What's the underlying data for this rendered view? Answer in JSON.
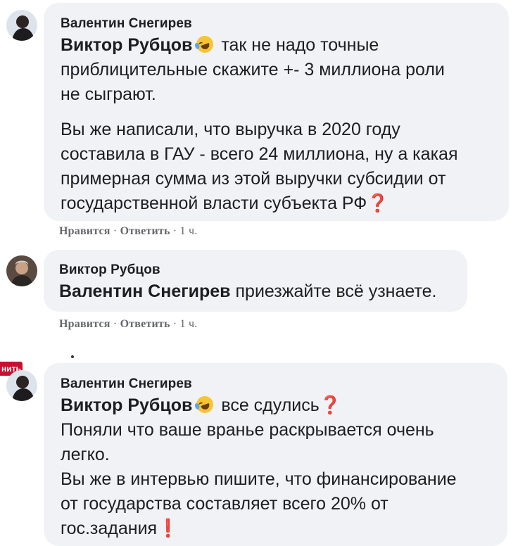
{
  "comments": [
    {
      "author": "Валентин Снегирев",
      "mention": "Виктор Рубцов",
      "line1_rest": "так не надо точные",
      "line2": "приблицительные скажите +- 3 миллиона роли",
      "line3": "не сыграют.",
      "para2": [
        "Вы же написали, что выручка в 2020 году",
        "составила в ГАУ - всего 24 миллиона, ну а какая",
        "примерная сумма из этой выручки субсидии от",
        "государственной власти субъекта РФ"
      ],
      "para2_end_mark": "❓",
      "actions": {
        "like": "Нравится",
        "sep1": " · ",
        "reply": "Ответить",
        "sep2": " · ",
        "time": "1 ч."
      }
    },
    {
      "author": "Виктор Рубцов",
      "mention": "Валентин Снегирев",
      "text": "приезжайте всё узнаете.",
      "actions": {
        "like": "Нравится",
        "sep1": " · ",
        "reply": "Ответить",
        "sep2": " · ",
        "time": "1 ч."
      }
    },
    {
      "author": "Валентин Снегирев",
      "mention": "Виктор Рубцов",
      "line1_rest": "все сдулись",
      "line1_mark": "❓",
      "lines": [
        "Поняли что ваше вранье раскрывается очень",
        "легко.",
        "Вы же в интервью пишите, что финансирование",
        "от государства составляет всего 20% от"
      ],
      "last_line": "гос.задания",
      "last_mark": "❗"
    }
  ],
  "side_badge": "нить",
  "icons": [
    "avatar-photo",
    "rolling-laughing-emoji",
    "red-question-emoji",
    "red-exclamation-emoji"
  ],
  "colors": {
    "bubble": "#f0f2f5",
    "meta": "#65676b",
    "accent_red": "#e0262c"
  }
}
